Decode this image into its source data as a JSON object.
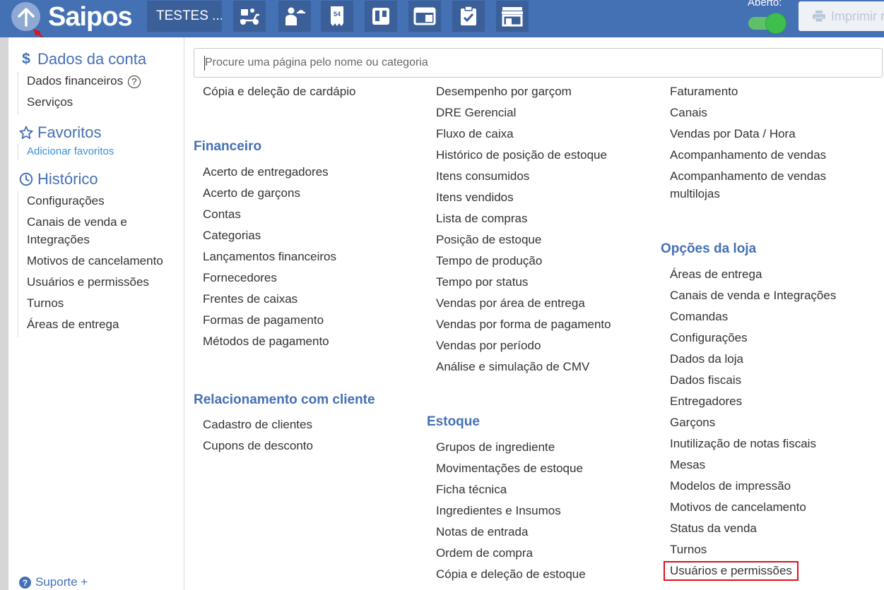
{
  "header": {
    "logo_text": "Saipos",
    "store_name": "TESTES ...",
    "toolbar_icons": [
      "delivery-scooter-icon",
      "waiter-icon",
      "ticket-icon",
      "kanban-board-icon",
      "layout-window-icon",
      "clipboard-check-icon",
      "storefront-icon"
    ],
    "status_label": "Aberto:",
    "status_open": true,
    "print_label": "Imprimir r"
  },
  "sidebar": {
    "account": {
      "title": "Dados da conta",
      "items": [
        "Dados financeiros",
        "Serviços"
      ]
    },
    "favorites": {
      "title": "Favoritos",
      "add_link": "Adicionar favoritos"
    },
    "history": {
      "title": "Histórico",
      "items": [
        "Configurações",
        "Canais de venda e Integrações",
        "Motivos de cancelamento",
        "Usuários e permissões",
        "Turnos",
        "Áreas de entrega"
      ]
    },
    "support_label": "Suporte +"
  },
  "search": {
    "placeholder": "Procure uma página pelo nome ou categoria"
  },
  "columns": {
    "col1": {
      "top_items": [
        "Cópia e deleção de cardápio"
      ],
      "financeiro": {
        "title": "Financeiro",
        "items": [
          "Acerto de entregadores",
          "Acerto de garçons",
          "Contas",
          "Categorias",
          "Lançamentos financeiros",
          "Fornecedores",
          "Frentes de caixas",
          "Formas de pagamento",
          "Métodos de pagamento"
        ]
      },
      "relacionamento": {
        "title": "Relacionamento com cliente",
        "items": [
          "Cadastro de clientes",
          "Cupons de desconto"
        ]
      }
    },
    "col2": {
      "top_items": [
        "Desempenho por garçom",
        "DRE Gerencial",
        "Fluxo de caixa",
        "Histórico de posição de estoque",
        "Itens consumidos",
        "Itens vendidos",
        "Lista de compras",
        "Posição de estoque",
        "Tempo de produção",
        "Tempo por status",
        "Vendas por área de entrega",
        "Vendas por forma de pagamento",
        "Vendas por período",
        "Análise e simulação de CMV"
      ],
      "estoque": {
        "title": "Estoque",
        "items": [
          "Grupos de ingrediente",
          "Movimentações de estoque",
          "Ficha técnica",
          "Ingredientes e Insumos",
          "Notas de entrada",
          "Ordem de compra",
          "Cópia e deleção de estoque"
        ]
      }
    },
    "col3": {
      "top_items": [
        "Faturamento",
        "Canais",
        "Vendas por Data / Hora",
        "Acompanhamento de vendas",
        "Acompanhamento de vendas multilojas"
      ],
      "opcoes": {
        "title": "Opções da loja",
        "items": [
          "Áreas de entrega",
          "Canais de venda e Integrações",
          "Comandas",
          "Configurações",
          "Dados da loja",
          "Dados fiscais",
          "Entregadores",
          "Garçons",
          "Inutilização de notas fiscais",
          "Mesas",
          "Modelos de impressão",
          "Motivos de cancelamento",
          "Status da venda",
          "Turnos",
          "Usuários e permissões"
        ]
      }
    }
  },
  "colors": {
    "primary": "#4470b4",
    "accent_link": "#3a8fd8",
    "toggle_on": "#3dbf4e",
    "highlight_box": "#e0101a"
  }
}
